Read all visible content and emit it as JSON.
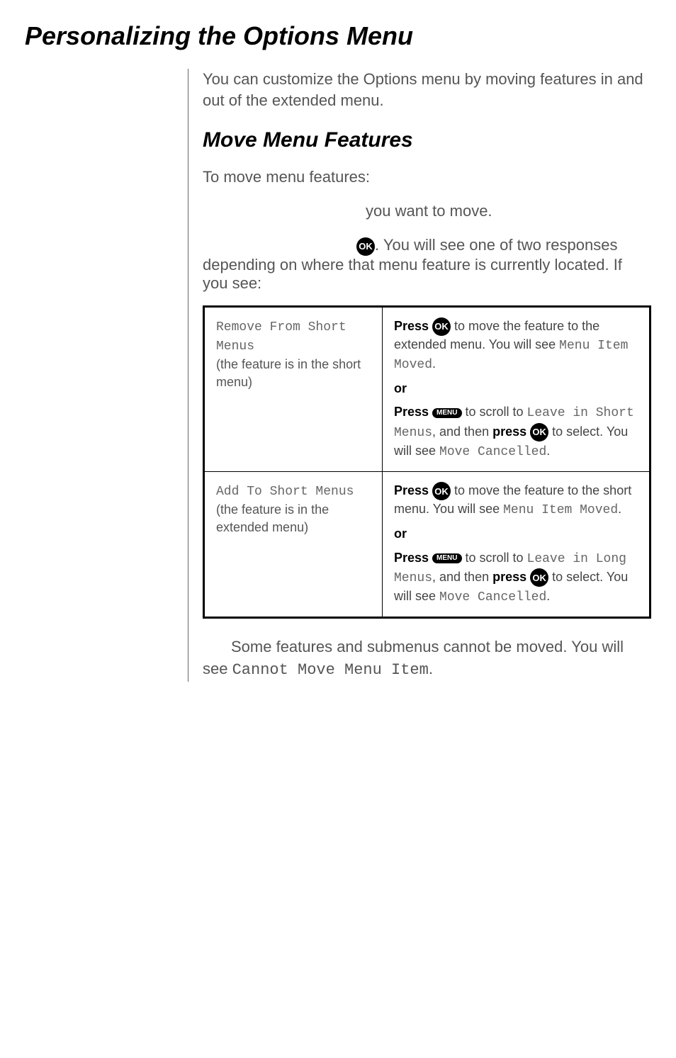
{
  "title": "Personalizing the Options Menu",
  "intro": "You can customize the Options menu by moving features in and out of the extended menu.",
  "section": {
    "heading": "Move Menu Features",
    "lead": "To move menu features:",
    "step_want": "you want to move.",
    "step_press_part1": ". You will see one of two responses depending on where that menu feature is currently located. If you see:",
    "icons": {
      "ok": "OK",
      "menu": "MENU"
    }
  },
  "table": {
    "rows": [
      {
        "left_mono": "Remove From Short Menus",
        "left_sub": "(the feature is in the short menu)",
        "right_press1a": "Press ",
        "right_press1b": " to move the feature to the extended menu. You will see ",
        "right_press1_mono": "Menu Item Moved",
        "right_press1_end": ".",
        "or": "or",
        "right_press2a": "Press ",
        "right_press2b": " to scroll to ",
        "right_press2_mono1": "Leave in Short Menus",
        "right_press2c": ", and then ",
        "right_press2_bold": "press ",
        "right_press2d": " to select. You will see ",
        "right_press2_mono2": "Move Cancelled",
        "right_press2_end": "."
      },
      {
        "left_mono": "Add To Short Menus",
        "left_sub": "(the feature is in the extended menu)",
        "right_press1a": "Press ",
        "right_press1b": " to move the feature to the short menu. You will see ",
        "right_press1_mono": "Menu Item Moved",
        "right_press1_end": ".",
        "or": "or",
        "right_press2a": "Press ",
        "right_press2b": " to scroll to ",
        "right_press2_mono1": "Leave in Long Menus",
        "right_press2c": ", and then ",
        "right_press2_bold": "press ",
        "right_press2d": " to select. You will see ",
        "right_press2_mono2": "Move Cancelled",
        "right_press2_end": "."
      }
    ]
  },
  "note_a": "Some features and submenus cannot be moved. You will see ",
  "note_mono": "Cannot Move Menu Item",
  "note_b": "."
}
